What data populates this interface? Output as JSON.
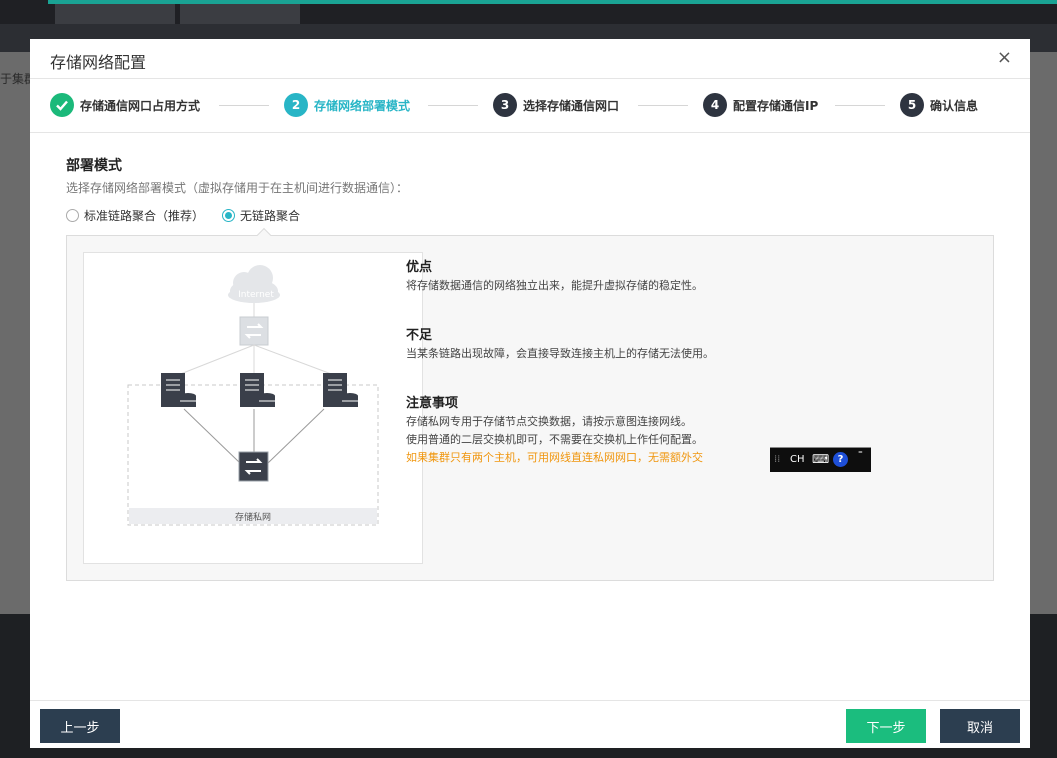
{
  "background": {
    "sidebar_fragment": "于集群"
  },
  "modal": {
    "title": "存储网络配置",
    "close_symbol": "×"
  },
  "steps": [
    {
      "num": "",
      "label": "存储通信网口占用方式",
      "state": "done"
    },
    {
      "num": "2",
      "label": "存储网络部署模式",
      "state": "active"
    },
    {
      "num": "3",
      "label": "选择存储通信网口",
      "state": "todo"
    },
    {
      "num": "4",
      "label": "配置存储通信IP",
      "state": "todo"
    },
    {
      "num": "5",
      "label": "确认信息",
      "state": "todo"
    }
  ],
  "section": {
    "title": "部署模式",
    "description": "选择存储网络部署模式（虚拟存储用于在主机间进行数据通信）：",
    "options": [
      {
        "label": "标准链路聚合（推荐）",
        "checked": false
      },
      {
        "label": "无链路聚合",
        "checked": true
      }
    ]
  },
  "diagram": {
    "cloud_label": "Internet",
    "private_net_label": "存储私网"
  },
  "info": {
    "pros_title": "优点",
    "pros_text": "将存储数据通信的网络独立出来，能提升虚拟存储的稳定性。",
    "cons_title": "不足",
    "cons_text": "当某条链路出现故障，会直接导致连接主机上的存储无法使用。",
    "notes_title": "注意事项",
    "notes_line1": "存储私网专用于存储节点交换数据，请按示意图连接网线。",
    "notes_line2": "使用普通的二层交换机即可，不需要在交换机上作任何配置。",
    "notes_warning": "如果集群只有两个主机，可用网线直连私网网口，无需额外交"
  },
  "ime": {
    "mode": "CH"
  },
  "footer": {
    "prev_label": "上一步",
    "next_label": "下一步",
    "cancel_label": "取消"
  },
  "colors": {
    "accent": "#28b5c6",
    "done": "#1bb97a",
    "dark": "#2c3e50",
    "warning": "#f0960e",
    "next_button": "#1bbd7e"
  }
}
